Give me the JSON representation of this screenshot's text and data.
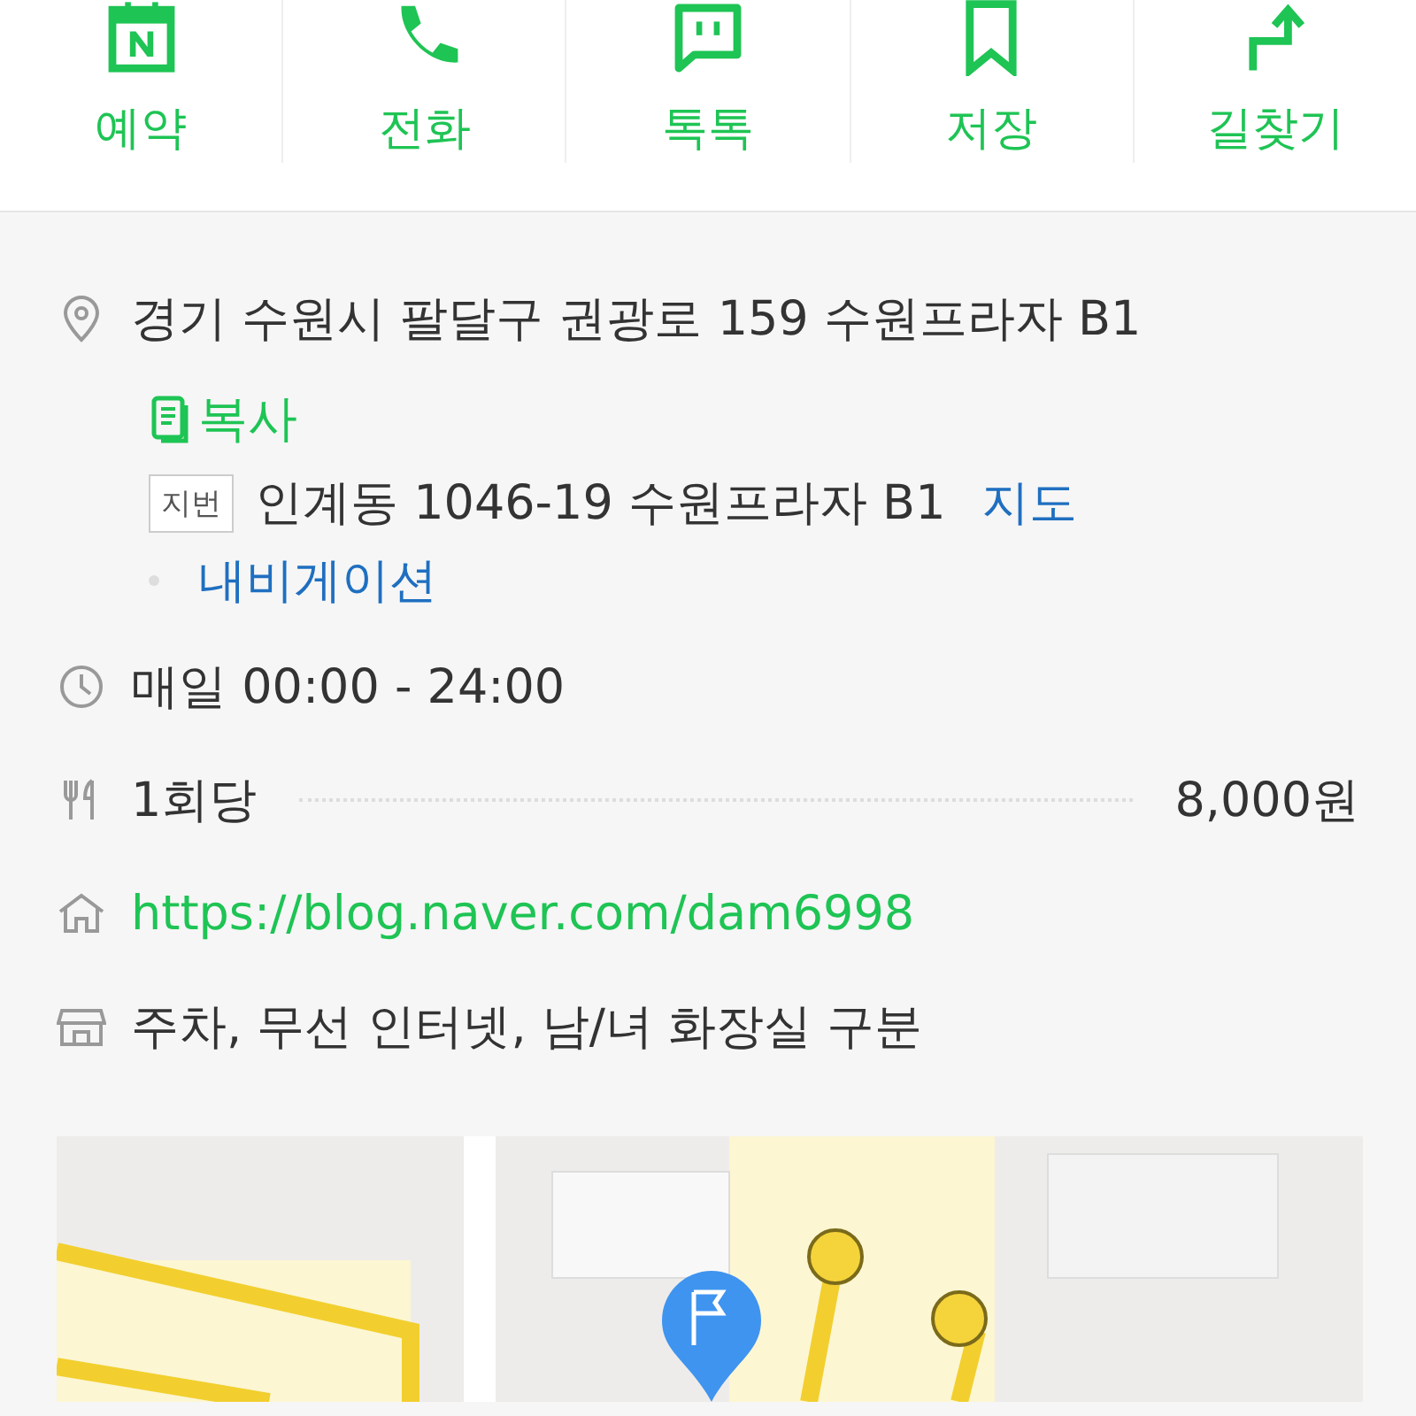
{
  "actions": [
    {
      "kind": "booking",
      "label": "예약"
    },
    {
      "kind": "call",
      "label": "전화"
    },
    {
      "kind": "talk",
      "label": "톡톡"
    },
    {
      "kind": "save",
      "label": "저장"
    },
    {
      "kind": "route",
      "label": "길찾기"
    }
  ],
  "address": {
    "road": "경기 수원시 팔달구 권광로 159 수원프라자 B1",
    "copy": "복사",
    "jibun_badge": "지번",
    "jibun": "인계동 1046-19 수원프라자 B1",
    "map_link": "지도",
    "nav_link": "내비게이션"
  },
  "hours": "매일 00:00 - 24:00",
  "price": {
    "label": "1회당",
    "value": "8,000원"
  },
  "homepage": "https://blog.naver.com/dam6998",
  "amenities": "주차, 무선 인터넷, 남/녀 화장실 구분"
}
